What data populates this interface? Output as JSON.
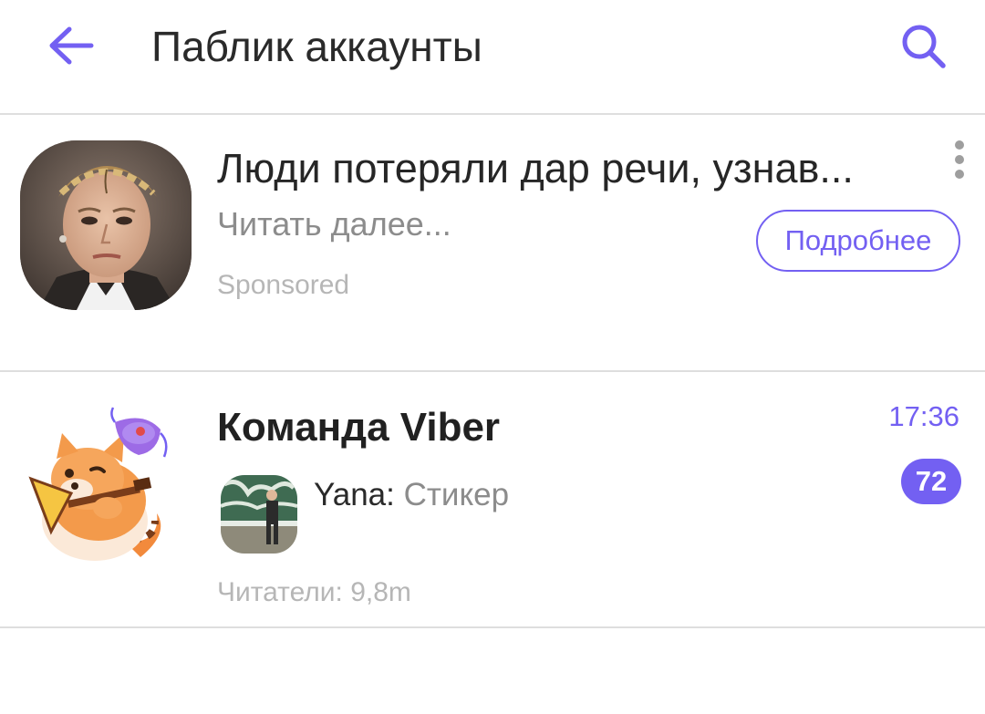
{
  "header": {
    "title": "Паблик аккаунты",
    "accent_color": "#7360f2",
    "back_icon": "arrow-left-icon",
    "search_icon": "search-icon"
  },
  "ad": {
    "headline": "Люди потеряли дар речи, узнав...",
    "read_more": "Читать далее...",
    "sponsored_label": "Sponsored",
    "button_label": "Подробнее",
    "menu_icon": "more-vertical-icon"
  },
  "chats": [
    {
      "name": "Команда Viber",
      "time": "17:36",
      "unread_count": "72",
      "sender": "Yana:",
      "message": "Стикер",
      "readers": "Читатели: 9,8m"
    }
  ]
}
